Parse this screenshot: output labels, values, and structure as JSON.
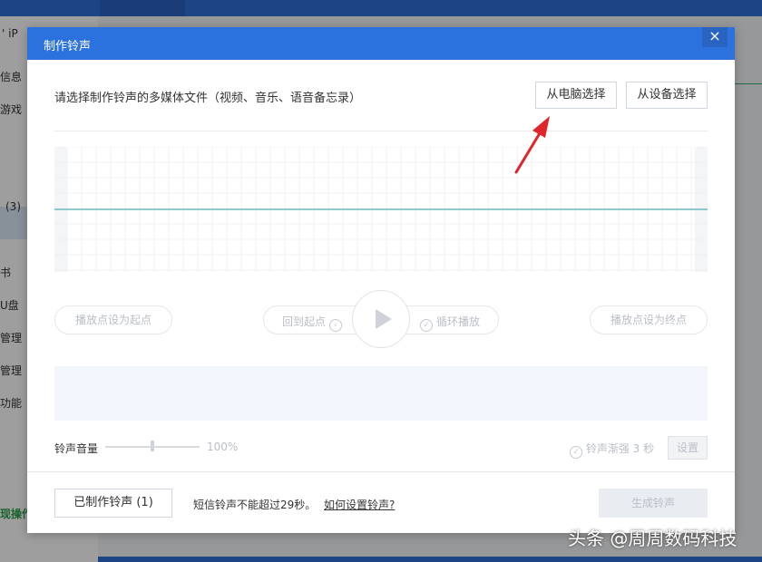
{
  "background": {
    "sidebar_items": [
      "信息",
      "游戏",
      "(3)",
      "书",
      "U盘",
      "管理",
      "管理",
      "功能",
      "现操作"
    ],
    "sidebar_top": "' iP"
  },
  "dialog": {
    "title": "制作铃声",
    "close_label": "×",
    "prompt": "请选择制作铃声的多媒体文件（视频、音乐、语音备忘录）",
    "from_pc_label": "从电脑选择",
    "from_device_label": "从设备选择",
    "set_start_label": "播放点设为起点",
    "back_to_start_label": "回到起点",
    "loop_label": "循环播放",
    "set_end_label": "播放点设为终点",
    "volume_label": "铃声音量",
    "volume_value": "100%",
    "volume_level": 0.5,
    "fade_label": "铃声渐强 3 秒",
    "set_label": "设置",
    "made_label": "已制作铃声 (1)",
    "sms_note": "短信铃声不能超过29秒。",
    "how_link": "如何设置铃声?",
    "generate_label": "生成铃声"
  },
  "colors": {
    "title_bar": "#2c72de",
    "waveform_line": "#2b9aa0",
    "arrow": "#e0242a"
  },
  "watermark": "头条 @周周数码科技"
}
